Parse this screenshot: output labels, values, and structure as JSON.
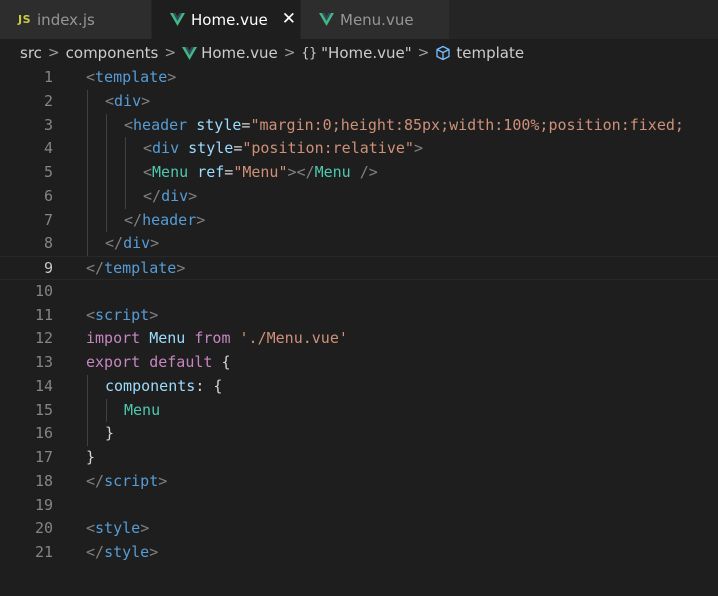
{
  "tabs": [
    {
      "label": "index.js",
      "icon": "js-icon",
      "active": false
    },
    {
      "label": "Home.vue",
      "icon": "vue-icon",
      "active": true
    },
    {
      "label": "Menu.vue",
      "icon": "vue-icon",
      "active": false
    }
  ],
  "breadcrumbs": [
    "src",
    "components",
    "Home.vue",
    "\"Home.vue\"",
    "template"
  ],
  "braces_symbol": "{}",
  "colors": {
    "tag": "#569cd6",
    "attribute": "#9cdcfe",
    "string": "#ce9178",
    "keyword": "#c586c0",
    "component": "#4ec9b0",
    "vue": "#41b883",
    "js": "#cbcb41"
  },
  "editor": {
    "current_line": 9,
    "lines": [
      {
        "n": "1",
        "indent": 0,
        "tokens": [
          [
            "br",
            "<"
          ],
          [
            "tag",
            "template"
          ],
          [
            "br",
            ">"
          ]
        ]
      },
      {
        "n": "2",
        "indent": 1,
        "tokens": [
          [
            "br",
            "<"
          ],
          [
            "tag",
            "div"
          ],
          [
            "br",
            ">"
          ]
        ]
      },
      {
        "n": "3",
        "indent": 2,
        "tokens": [
          [
            "br",
            "<"
          ],
          [
            "tag",
            "header"
          ],
          [
            "op",
            " "
          ],
          [
            "attr",
            "style"
          ],
          [
            "op",
            "="
          ],
          [
            "str",
            "\"margin:0;height:85px;width:100%;position:fixed;"
          ]
        ]
      },
      {
        "n": "4",
        "indent": 3,
        "tokens": [
          [
            "br",
            "<"
          ],
          [
            "tag",
            "div"
          ],
          [
            "op",
            " "
          ],
          [
            "attr",
            "style"
          ],
          [
            "op",
            "="
          ],
          [
            "str",
            "\"position:relative\""
          ],
          [
            "br",
            ">"
          ]
        ]
      },
      {
        "n": "5",
        "indent": 3,
        "tokens": [
          [
            "br",
            "<"
          ],
          [
            "cmp",
            "Menu"
          ],
          [
            "op",
            " "
          ],
          [
            "attr",
            "ref"
          ],
          [
            "op",
            "="
          ],
          [
            "str",
            "\"Menu\""
          ],
          [
            "br",
            "></"
          ],
          [
            "cmp",
            "Menu"
          ],
          [
            "op",
            " "
          ],
          [
            "br",
            "/>"
          ]
        ]
      },
      {
        "n": "6",
        "indent": 3,
        "tokens": [
          [
            "br",
            "</"
          ],
          [
            "tag",
            "div"
          ],
          [
            "br",
            ">"
          ]
        ]
      },
      {
        "n": "7",
        "indent": 2,
        "tokens": [
          [
            "br",
            "</"
          ],
          [
            "tag",
            "header"
          ],
          [
            "br",
            ">"
          ]
        ]
      },
      {
        "n": "8",
        "indent": 1,
        "tokens": [
          [
            "br",
            "</"
          ],
          [
            "tag",
            "div"
          ],
          [
            "br",
            ">"
          ]
        ]
      },
      {
        "n": "9",
        "indent": 0,
        "tokens": [
          [
            "br",
            "</"
          ],
          [
            "tag",
            "template"
          ],
          [
            "br",
            ">"
          ]
        ]
      },
      {
        "n": "10",
        "indent": 0,
        "tokens": []
      },
      {
        "n": "11",
        "indent": 0,
        "tokens": [
          [
            "br",
            "<"
          ],
          [
            "tag",
            "script"
          ],
          [
            "br",
            ">"
          ]
        ]
      },
      {
        "n": "12",
        "indent": 0,
        "tokens": [
          [
            "kw",
            "import"
          ],
          [
            "op",
            " "
          ],
          [
            "attr",
            "Menu"
          ],
          [
            "op",
            " "
          ],
          [
            "kw",
            "from"
          ],
          [
            "op",
            " "
          ],
          [
            "str",
            "'./Menu.vue'"
          ]
        ]
      },
      {
        "n": "13",
        "indent": 0,
        "tokens": [
          [
            "kw",
            "export"
          ],
          [
            "op",
            " "
          ],
          [
            "kw",
            "default"
          ],
          [
            "op",
            " {"
          ]
        ]
      },
      {
        "n": "14",
        "indent": 1,
        "tokens": [
          [
            "attr",
            "components"
          ],
          [
            "op",
            ": {"
          ]
        ]
      },
      {
        "n": "15",
        "indent": 2,
        "tokens": [
          [
            "cmp",
            "Menu"
          ]
        ]
      },
      {
        "n": "16",
        "indent": 1,
        "tokens": [
          [
            "op",
            "}"
          ]
        ]
      },
      {
        "n": "17",
        "indent": 0,
        "tokens": [
          [
            "op",
            "}"
          ]
        ]
      },
      {
        "n": "18",
        "indent": 0,
        "tokens": [
          [
            "br",
            "</"
          ],
          [
            "tag",
            "script"
          ],
          [
            "br",
            ">"
          ]
        ]
      },
      {
        "n": "19",
        "indent": 0,
        "tokens": []
      },
      {
        "n": "20",
        "indent": 0,
        "tokens": [
          [
            "br",
            "<"
          ],
          [
            "tag",
            "style"
          ],
          [
            "br",
            ">"
          ]
        ]
      },
      {
        "n": "21",
        "indent": 0,
        "tokens": [
          [
            "br",
            "</"
          ],
          [
            "tag",
            "style"
          ],
          [
            "br",
            ">"
          ]
        ]
      }
    ]
  }
}
